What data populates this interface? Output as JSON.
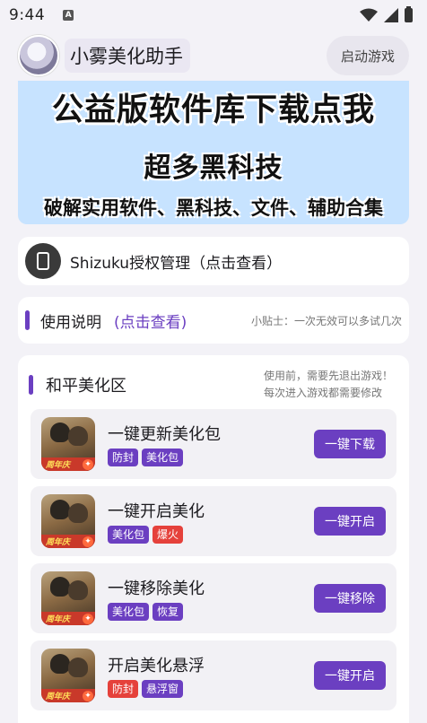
{
  "status_bar": {
    "time": "9:44",
    "notif_letter": "A"
  },
  "header": {
    "title": "小雾美化助手",
    "launch_label": "启动游戏"
  },
  "banner": {
    "line1": "公益版软件库下载点我",
    "line2": "超多黑科技",
    "line3": "破解实用软件、黑科技、文件、辅助合集"
  },
  "shizuku": {
    "label": "Shizuku授权管理（点击查看）"
  },
  "guide": {
    "title": "使用说明",
    "link": "(点击查看)",
    "tip": "小贴士：一次无效可以多试几次"
  },
  "section": {
    "title": "和平美化区",
    "note_line1": "使用前，需要先退出游戏！",
    "note_line2": "每次进入游戏都需要修改",
    "items": [
      {
        "title": "一键更新美化包",
        "tags": [
          "防封",
          "美化包"
        ],
        "button": "一键下载"
      },
      {
        "title": "一键开启美化",
        "tags": [
          "美化包",
          "爆火"
        ],
        "button": "一键开启"
      },
      {
        "title": "一键移除美化",
        "tags": [
          "美化包",
          "恢复"
        ],
        "button": "一键移除"
      },
      {
        "title": "开启美化悬浮",
        "tags": [
          "防封",
          "悬浮窗"
        ],
        "button": "一键开启"
      }
    ],
    "icon_badge": "周年庆"
  },
  "colors": {
    "accent": "#6b3fc1",
    "tag_red": "#e5413b",
    "banner_bg": "#c7e3ff"
  }
}
